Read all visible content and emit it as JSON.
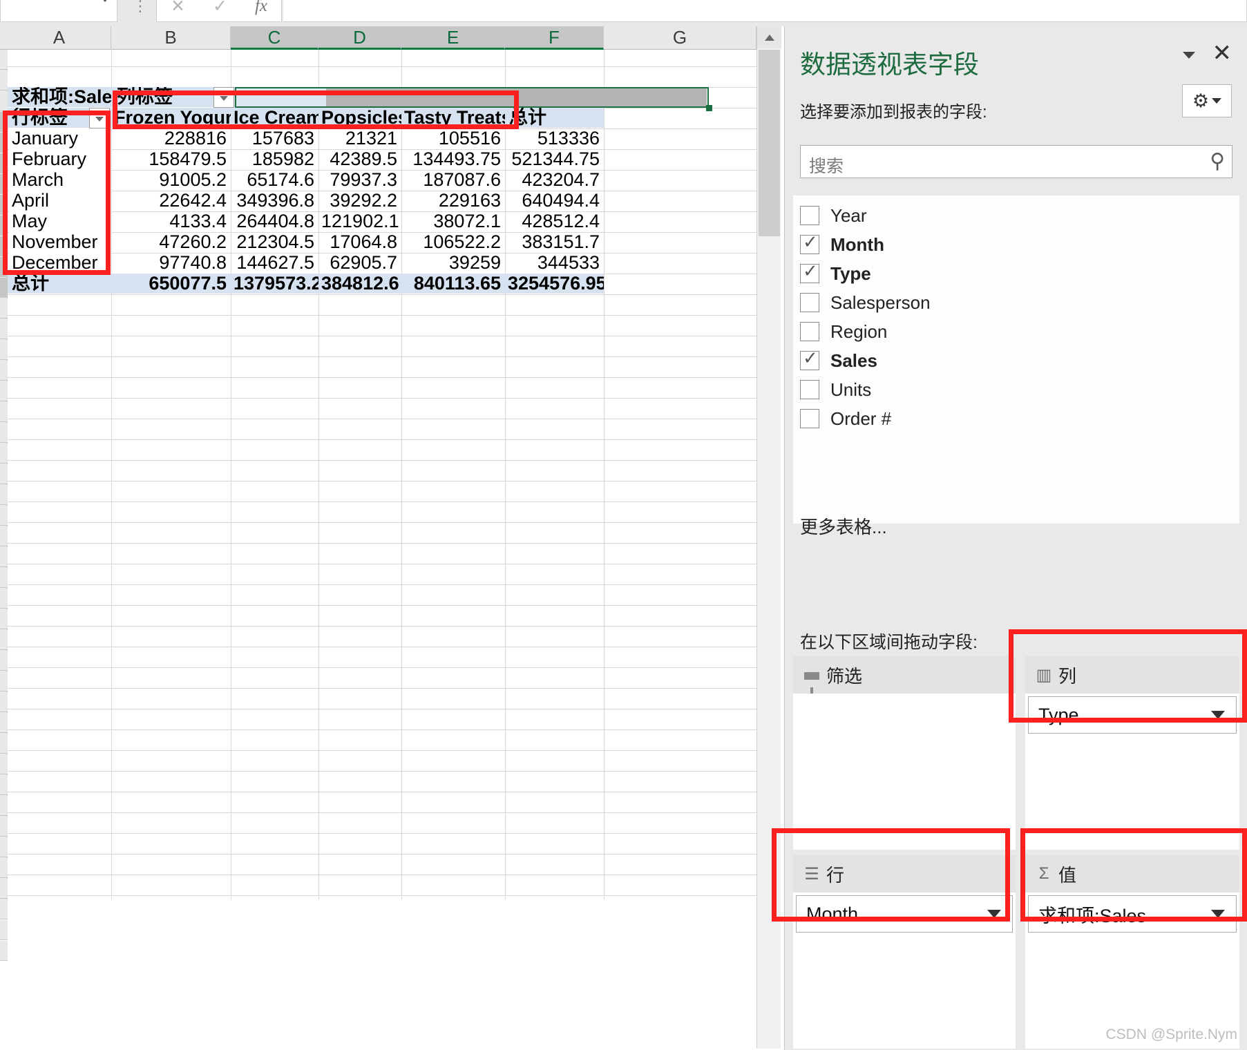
{
  "formula_bar": {
    "name_box_value": "",
    "cancel_icon": "cancel-icon",
    "confirm_icon": "confirm-icon",
    "fx_label": "fx",
    "input_value": ""
  },
  "sheet": {
    "column_headers": [
      "A",
      "B",
      "C",
      "D",
      "E",
      "F",
      "G"
    ],
    "selected_columns": [
      "C",
      "D",
      "E",
      "F"
    ],
    "pivot": {
      "value_field_caption": "求和项:Sales",
      "column_labels_caption": "列标签",
      "row_labels_caption": "行标签",
      "column_headers": [
        "Frozen Yogurt",
        "Ice Cream",
        "Popsicles",
        "Tasty Treats",
        "总计"
      ],
      "rows": [
        {
          "label": "January",
          "values": [
            "228816",
            "157683",
            "21321",
            "105516",
            "513336"
          ]
        },
        {
          "label": "February",
          "values": [
            "158479.5",
            "185982",
            "42389.5",
            "134493.75",
            "521344.75"
          ]
        },
        {
          "label": "March",
          "values": [
            "91005.2",
            "65174.6",
            "79937.3",
            "187087.6",
            "423204.7"
          ]
        },
        {
          "label": "April",
          "values": [
            "22642.4",
            "349396.8",
            "39292.2",
            "229163",
            "640494.4"
          ]
        },
        {
          "label": "May",
          "values": [
            "4133.4",
            "264404.8",
            "121902.1",
            "38072.1",
            "428512.4"
          ]
        },
        {
          "label": "November",
          "values": [
            "47260.2",
            "212304.5",
            "17064.8",
            "106522.2",
            "383151.7"
          ]
        },
        {
          "label": "December",
          "values": [
            "97740.8",
            "144627.5",
            "62905.7",
            "39259",
            "344533"
          ]
        }
      ],
      "grand_total_row": {
        "label": "总计",
        "values": [
          "650077.5",
          "1379573.2",
          "384812.6",
          "840113.65",
          "3254576.95"
        ]
      }
    }
  },
  "pane": {
    "title": "数据透视表字段",
    "collapse_icon": "chevron-down-icon",
    "close_icon": "close-icon",
    "subtitle": "选择要添加到报表的字段:",
    "gear_icon": "gear-icon",
    "gear_caret_icon": "chevron-down-icon",
    "search": {
      "placeholder": "搜索",
      "value": "",
      "icon": "search-icon"
    },
    "fields": [
      {
        "label": "Year",
        "checked": false
      },
      {
        "label": "Month",
        "checked": true
      },
      {
        "label": "Type",
        "checked": true
      },
      {
        "label": "Salesperson",
        "checked": false
      },
      {
        "label": "Region",
        "checked": false
      },
      {
        "label": "Sales",
        "checked": true
      },
      {
        "label": "Units",
        "checked": false
      },
      {
        "label": "Order #",
        "checked": false
      }
    ],
    "more_tables": "更多表格...",
    "drag_hint": "在以下区域间拖动字段:",
    "zones": {
      "filters": {
        "title": "筛选",
        "icon": "funnel-icon",
        "items": []
      },
      "columns": {
        "title": "列",
        "icon": "columns-icon",
        "items": [
          "Type"
        ]
      },
      "rows": {
        "title": "行",
        "icon": "rows-icon",
        "items": [
          "Month"
        ]
      },
      "values": {
        "title": "值",
        "icon": "sigma-icon",
        "items": [
          "求和项:Sales"
        ]
      }
    }
  },
  "watermark": "CSDN @Sprite.Nym"
}
